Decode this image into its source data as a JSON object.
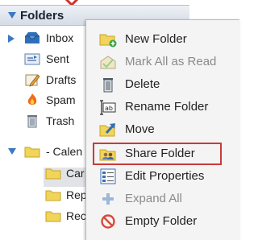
{
  "folders": {
    "header": "Folders",
    "items": [
      {
        "label": "Inbox",
        "icon": "inbox-icon"
      },
      {
        "label": "Sent",
        "icon": "sent-icon"
      },
      {
        "label": "Drafts",
        "icon": "drafts-icon"
      },
      {
        "label": "Spam",
        "icon": "spam-icon"
      },
      {
        "label": "Trash",
        "icon": "trash-icon"
      }
    ],
    "parent": {
      "label": "- Calen",
      "icon": "folder-icon"
    },
    "children": [
      {
        "label": "Car"
      },
      {
        "label": "Rep"
      },
      {
        "label": "Rec"
      }
    ]
  },
  "menu": {
    "items": [
      {
        "label": "New Folder",
        "icon": "new-folder-icon",
        "enabled": true
      },
      {
        "label": "Mark All as Read",
        "icon": "mark-read-icon",
        "enabled": false
      },
      {
        "label": "Delete",
        "icon": "delete-icon",
        "enabled": true
      },
      {
        "label": "Rename Folder",
        "icon": "rename-icon",
        "enabled": true
      },
      {
        "label": "Move",
        "icon": "move-icon",
        "enabled": true
      },
      {
        "label": "Share Folder",
        "icon": "share-folder-icon",
        "enabled": true,
        "highlighted": true
      },
      {
        "label": "Edit Properties",
        "icon": "properties-icon",
        "enabled": true
      },
      {
        "label": "Expand All",
        "icon": "expand-icon",
        "enabled": false
      },
      {
        "label": "Empty Folder",
        "icon": "empty-folder-icon",
        "enabled": true
      }
    ]
  },
  "colors": {
    "highlight_border": "#c93a3a",
    "header_bg": "#dde2ea",
    "menu_bg": "#f4f4f4"
  }
}
